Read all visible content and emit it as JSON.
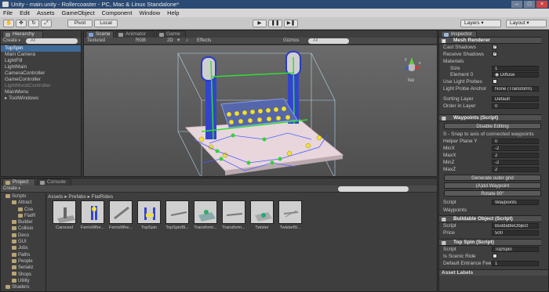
{
  "window": {
    "title": "Unity - main.unity - Rollercoaster - PC, Mac & Linux Standalone*"
  },
  "menu": [
    "File",
    "Edit",
    "Assets",
    "GameObject",
    "Component",
    "Window",
    "Help"
  ],
  "toolbar": {
    "pivot": "Pivot",
    "local": "Local",
    "layers": "Layers",
    "layout": "Layout"
  },
  "hierarchy": {
    "tab": "Hierarchy",
    "create": "Create",
    "search": "All",
    "items": [
      {
        "label": "TopSpin",
        "selected": true
      },
      {
        "label": "Main Camera"
      },
      {
        "label": "LightFill"
      },
      {
        "label": "LightMain"
      },
      {
        "label": "CameraController"
      },
      {
        "label": "GameController"
      },
      {
        "label": "LightMoodController",
        "dim": true
      },
      {
        "label": "MainMenu"
      },
      {
        "label": "ToolWindows",
        "arrow": true
      }
    ]
  },
  "scene": {
    "tabs": [
      "Scene",
      "Animator",
      "Game"
    ],
    "shading": "Textured",
    "render": "RGB",
    "mode2d": "2D",
    "effects": "Effects",
    "gizmos": "Gizmos",
    "search": "All",
    "persp": "Iso",
    "axis_x": "x",
    "axis_y": "y"
  },
  "project": {
    "tabs": [
      "Project",
      "Console"
    ],
    "create": "Create",
    "tree": [
      {
        "label": "Scripts",
        "indent": 1
      },
      {
        "label": "Attract",
        "indent": 2
      },
      {
        "label": "Coa",
        "indent": 3
      },
      {
        "label": "FlatR",
        "indent": 3
      },
      {
        "label": "Builder",
        "indent": 2
      },
      {
        "label": "Collisio",
        "indent": 2
      },
      {
        "label": "Deco",
        "indent": 2
      },
      {
        "label": "GUI",
        "indent": 2
      },
      {
        "label": "Jobs",
        "indent": 2
      },
      {
        "label": "Paths",
        "indent": 2
      },
      {
        "label": "People",
        "indent": 2
      },
      {
        "label": "Serializ",
        "indent": 2
      },
      {
        "label": "Shops",
        "indent": 2
      },
      {
        "label": "Utility",
        "indent": 2
      },
      {
        "label": "Shaders",
        "indent": 1
      }
    ],
    "breadcrumb": [
      "Assets",
      "Prefabs",
      "FlatRides"
    ],
    "assets": [
      "Carousel",
      "FerrisWhe...",
      "FerrisWhe...",
      "TopSpin",
      "TopSpinBl...",
      "Transform...",
      "Transform...",
      "Twister",
      "TwisterBl..."
    ]
  },
  "inspector": {
    "tab": "Inspector",
    "mesh_renderer": {
      "title": "Mesh Renderer",
      "cast": "Cast Shadows",
      "receive": "Receive Shadows",
      "materials": "Materials",
      "size_label": "Size",
      "size": "1",
      "el_label": "Element 0",
      "el": "Diffuse",
      "probes": "Use Light Probes",
      "anchor_label": "Light Probe Anchor",
      "anchor": "None (Transform)",
      "sort_label": "Sorting Layer",
      "sort": "Default",
      "order_label": "Order in Layer",
      "order": "0"
    },
    "waypoints": {
      "title": "Waypoints (Script)",
      "disable": "Disable Editing",
      "hint": "S - Snap to axis of connected waypoints",
      "fields": [
        {
          "k": "Helper Plane Y",
          "v": "0"
        },
        {
          "k": "MinX",
          "v": "-2"
        },
        {
          "k": "MaxX",
          "v": "2"
        },
        {
          "k": "MinZ",
          "v": "-2"
        },
        {
          "k": "MaxZ",
          "v": "2"
        }
      ],
      "outer": "Generate outer grid",
      "add": "(A)dd Waypoint",
      "rotate": "Rotate 90°",
      "script_label": "Script",
      "script": "Waypoints",
      "wp": "Waypoints"
    },
    "buildable": {
      "title": "Buildable Object (Script)",
      "script_label": "Script",
      "script": "BuildableObject",
      "price_label": "Price",
      "price": "500"
    },
    "topspin": {
      "title": "Top Spin (Script)",
      "script_label": "Script",
      "script": "TopSpin",
      "scenic": "Is Scenic Ride",
      "entrance": "Default Entrance Fee",
      "entrance_val": "1"
    },
    "asset_labels": "Asset Labels"
  }
}
